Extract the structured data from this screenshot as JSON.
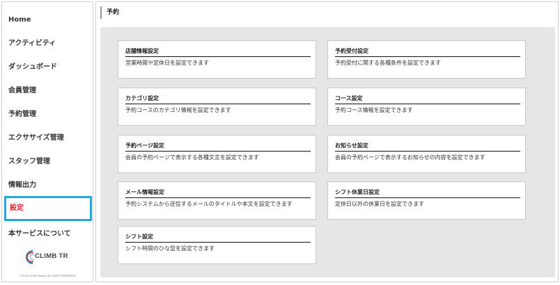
{
  "sidebar": {
    "items": [
      {
        "label": "Home"
      },
      {
        "label": "アクティビティ"
      },
      {
        "label": "ダッシュボード"
      },
      {
        "label": "会員管理"
      },
      {
        "label": "予約管理"
      },
      {
        "label": "エクササイズ管理"
      },
      {
        "label": "スタッフ管理"
      },
      {
        "label": "情報出力"
      },
      {
        "label": "設定"
      },
      {
        "label": "本サービスについて"
      }
    ],
    "active_item": "設定",
    "logo_text": "CLIMB TR",
    "copyright": "©2018 CLIMB Factory ALL RIGHTS RESERVED."
  },
  "header": {
    "title": "予約"
  },
  "colors": {
    "active_text": "#d9262e",
    "active_border": "#1ea7e1",
    "logo_blue": "#2a8fd8",
    "logo_red": "#e83b3b"
  },
  "cards": [
    {
      "title": "店舗情報設定",
      "desc": "営業時間や定休日を設定できます"
    },
    {
      "title": "予約受付設定",
      "desc": "予約受付に関する各種条件を設定できます"
    },
    {
      "title": "カテゴリ設定",
      "desc": "予約コースのカテゴリ情報を設定できます"
    },
    {
      "title": "コース設定",
      "desc": "予約コース情報を設定できます"
    },
    {
      "title": "予約ページ設定",
      "desc": "会員の予約ページで表示する各種文言を設定できます"
    },
    {
      "title": "お知らせ設定",
      "desc": "会員の予約ページで表示するお知らせの内容を設定できます"
    },
    {
      "title": "メール情報設定",
      "desc": "予約システムから送信するメールのタイトルや本文を設定できます"
    },
    {
      "title": "シフト休業日設定",
      "desc": "定休日以外の休業日を設定できます"
    },
    {
      "title": "シフト設定",
      "desc": "シフト時間のひな型を設定できます"
    }
  ]
}
